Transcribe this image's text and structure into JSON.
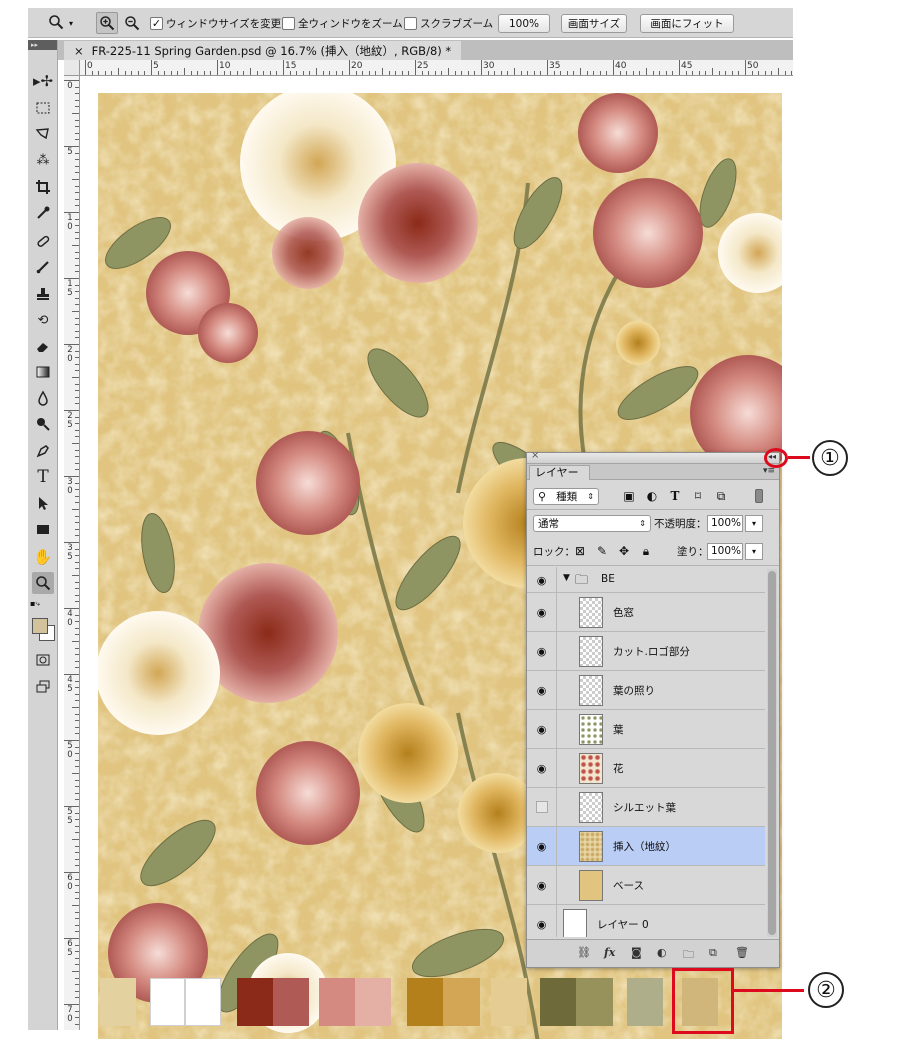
{
  "options_bar": {
    "zoom_tool_icon": "zoom-magnifier-icon",
    "resize_windows_label": "ウィンドウサイズを変更",
    "resize_windows_checked": true,
    "zoom_all_label": "全ウィンドウをズーム",
    "zoom_all_checked": false,
    "scrubby_zoom_label": "スクラブズーム",
    "scrubby_zoom_checked": false,
    "btn_100": "100%",
    "btn_fit_screen": "画面サイズ",
    "btn_fill_screen": "画面にフィット"
  },
  "document": {
    "tab_title": "FR-225-11 Spring Garden.psd @ 16.7% (挿入（地紋）, RGB/8) *",
    "close_label": "×"
  },
  "ruler": {
    "top_labels": [
      "0",
      "5",
      "10",
      "15",
      "20",
      "25",
      "30",
      "35",
      "40",
      "45",
      "50"
    ],
    "left_labels": [
      "0",
      "5",
      "10",
      "15",
      "20",
      "25",
      "30",
      "35",
      "40",
      "45",
      "50",
      "55",
      "60",
      "65",
      "70"
    ]
  },
  "layers_panel": {
    "tab_label": "レイヤー",
    "filter_kind": "種類",
    "blend_mode": "通常",
    "opacity_label": "不透明度：",
    "opacity_value": "100%",
    "lock_label": "ロック：",
    "fill_label": "塗り：",
    "fill_value": "100%",
    "group_name": "BE",
    "layers": [
      {
        "name": "色窓",
        "visible": true,
        "selected": false
      },
      {
        "name": "カット.ロゴ部分",
        "visible": true,
        "selected": false
      },
      {
        "name": "葉の照り",
        "visible": true,
        "selected": false
      },
      {
        "name": "葉",
        "visible": true,
        "selected": false
      },
      {
        "name": "花",
        "visible": true,
        "selected": false
      },
      {
        "name": "シルエット葉",
        "visible": false,
        "selected": false
      },
      {
        "name": "挿入（地紋）",
        "visible": true,
        "selected": true
      },
      {
        "name": "ベース",
        "visible": true,
        "selected": false
      },
      {
        "name": "レイヤー 0",
        "visible": true,
        "selected": false
      }
    ],
    "footer_fx": "fx"
  },
  "palette": [
    "#e4d1a0",
    "#ffffff",
    "#ffffff",
    "#8b2a18",
    "#b05a55",
    "#d48a80",
    "#e4b0a6",
    "#b4801c",
    "#d2a655",
    "#e4cc93",
    "#6f6a39",
    "#97925c",
    "#aeae8a",
    "#d1b67b"
  ],
  "callouts": [
    "①",
    "②"
  ],
  "colors": {
    "highlight_red": "#dd0a1d",
    "selected_layer": "#b9cdf5",
    "background_tan": "#e0c480"
  }
}
